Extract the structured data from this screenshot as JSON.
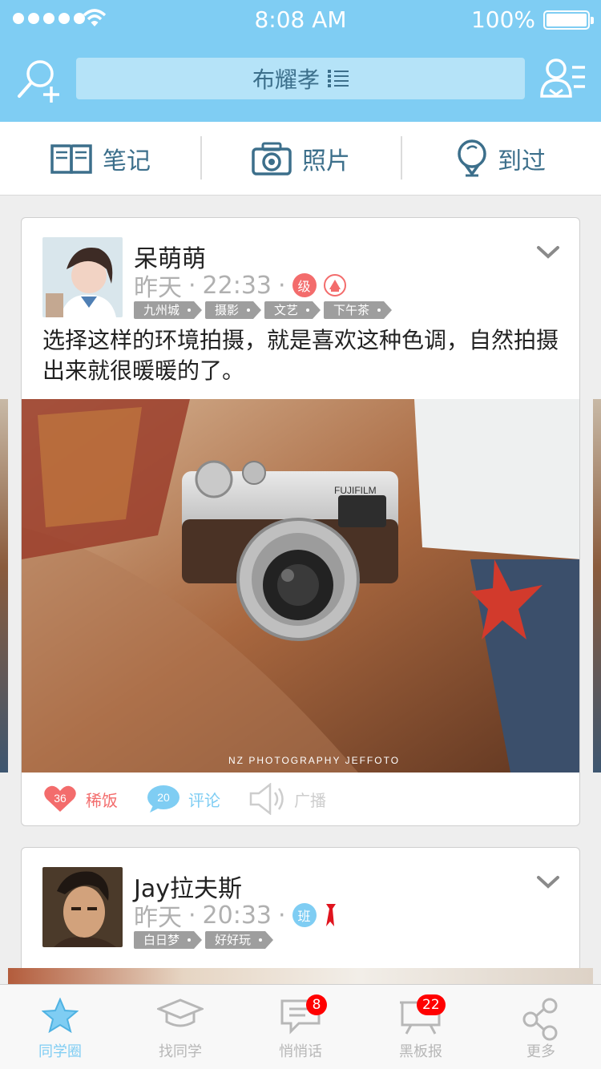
{
  "status_bar": {
    "time": "8:08 AM",
    "battery": "100%"
  },
  "header": {
    "title": "布耀孝"
  },
  "top_tabs": [
    {
      "label": "笔记",
      "icon": "notebook-icon"
    },
    {
      "label": "照片",
      "icon": "camera-icon"
    },
    {
      "label": "到过",
      "icon": "location-pin-icon"
    }
  ],
  "posts": [
    {
      "author": "呆萌萌",
      "day": "昨天",
      "time": "22:33",
      "badge": "级",
      "tags": [
        "九州城",
        "摄影",
        "文艺",
        "下午茶"
      ],
      "text": "选择这样的环境拍摄，就是喜欢这种色调，自然拍摄出来就很暖暖的了。",
      "photo_watermark": "NZ PHOTOGRAPHY JEFFOTO",
      "photo_brand": "FUJIFILM",
      "actions": {
        "like_count": "36",
        "like_label": "稀饭",
        "comment_count": "20",
        "comment_label": "评论",
        "share_label": "广播"
      }
    },
    {
      "author": "Jay拉夫斯",
      "day": "昨天",
      "time": "20:33",
      "badge": "班",
      "tags": [
        "白日梦",
        "好好玩"
      ]
    }
  ],
  "bottom_tabs": [
    {
      "label": "同学圈",
      "icon": "star-icon",
      "active": true
    },
    {
      "label": "找同学",
      "icon": "graduation-cap-icon"
    },
    {
      "label": "悄悄话",
      "icon": "chat-bubble-icon",
      "count": "8"
    },
    {
      "label": "黑板报",
      "icon": "blackboard-icon",
      "count": "22"
    },
    {
      "label": "更多",
      "icon": "share-nodes-icon"
    }
  ],
  "colors": {
    "brand": "#7fcdf3",
    "text_blue": "#3c6f8b",
    "like": "#f36c6c",
    "badge_red": "#ff0000"
  }
}
